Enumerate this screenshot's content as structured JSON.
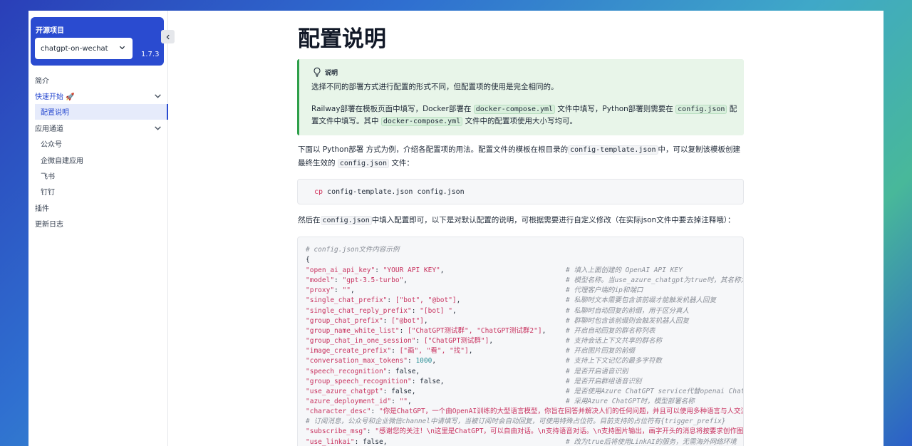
{
  "sidebar": {
    "project_title": "开源项目",
    "project_select": "chatgpt-on-wechat",
    "version": "1.7.3",
    "nav": [
      {
        "label": "简介",
        "type": "top"
      },
      {
        "label": "快速开始 🚀",
        "type": "top",
        "expanded": true
      },
      {
        "label": "配置说明",
        "type": "sub",
        "active": true
      },
      {
        "label": "应用通道",
        "type": "top",
        "expanded": true
      },
      {
        "label": "公众号",
        "type": "sub"
      },
      {
        "label": "企微自建应用",
        "type": "sub"
      },
      {
        "label": "飞书",
        "type": "sub"
      },
      {
        "label": "钉钉",
        "type": "sub"
      },
      {
        "label": "插件",
        "type": "top"
      },
      {
        "label": "更新日志",
        "type": "top"
      }
    ]
  },
  "main": {
    "title": "配置说明",
    "tip": {
      "heading": "说明",
      "p1": "选择不同的部署方式进行配置的形式不同，但配置项的使用是完全相同的。",
      "p2_a": "Railway部署在模板页面中填写，Docker部署在",
      "p2_code1": "docker-compose.yml",
      "p2_b": "文件中填写，Python部署则需要在",
      "p2_code2": "config.json",
      "p2_c": "配置文件中填写。其中",
      "p2_code3": "docker-compose.yml",
      "p2_d": "文件中的配置项使用大小写均可。"
    },
    "para1_a": "下面以 Python部署 方式为例，介绍各配置项的用法。配置文件的模板在根目录的",
    "para1_code1": "config-template.json",
    "para1_b": "中，可以复制该模板创建最终生效的",
    "para1_code2": "config.json",
    "para1_c": "文件：",
    "command_kw": "cp",
    "command_rest": "config-template.json config.json",
    "para2_a": "然后在",
    "para2_code": "config.json",
    "para2_b": "中填入配置即可，以下是对默认配置的说明，可根据需要进行自定义修改（在实际json文件中要去掉注释哦）：",
    "code_header_comment": "# config.json文件内容示例",
    "code_open_brace": "{",
    "config_lines": [
      {
        "key": "\"open_ai_api_key\"",
        "value": "\"YOUR API KEY\"",
        "vtype": "s",
        "comment": "# 填入上面创建的 OpenAI API KEY"
      },
      {
        "key": "\"model\"",
        "value": "\"gpt-3.5-turbo\"",
        "vtype": "s",
        "comment": "# 模型名称。当use_azure_chatgpt为true时，其名称为Azure上model deployment名称"
      },
      {
        "key": "\"proxy\"",
        "value": "\"\"",
        "vtype": "s",
        "comment": "# 代理客户端的ip和端口"
      },
      {
        "key": "\"single_chat_prefix\"",
        "value": "[\"bot\", \"@bot\"]",
        "vtype": "s",
        "comment": "# 私聊时文本需要包含该前缀才能触发机器人回复"
      },
      {
        "key": "\"single_chat_reply_prefix\"",
        "value": "\"[bot] \"",
        "vtype": "s",
        "comment": "# 私聊时自动回复的前缀，用于区分真人"
      },
      {
        "key": "\"group_chat_prefix\"",
        "value": "[\"@bot\"]",
        "vtype": "s",
        "comment": "# 群聊时包含该前缀则会触发机器人回复"
      },
      {
        "key": "\"group_name_white_list\"",
        "value": "[\"ChatGPT测试群\", \"ChatGPT测试群2\"]",
        "vtype": "s",
        "comment": "# 开启自动回复的群名称列表"
      },
      {
        "key": "\"group_chat_in_one_session\"",
        "value": "[\"ChatGPT测试群\"]",
        "vtype": "s",
        "comment": "# 支持会话上下文共享的群名称"
      },
      {
        "key": "\"image_create_prefix\"",
        "value": "[\"画\", \"看\", \"找\"]",
        "vtype": "s",
        "comment": "# 开启图片回复的前缀"
      },
      {
        "key": "\"conversation_max_tokens\"",
        "value": "1000",
        "vtype": "n",
        "comment": "# 支持上下文记忆的最多字符数"
      },
      {
        "key": "\"speech_recognition\"",
        "value": "false",
        "vtype": "p",
        "comment": "# 是否开启语音识别"
      },
      {
        "key": "\"group_speech_recognition\"",
        "value": "false",
        "vtype": "p",
        "comment": "# 是否开启群组语音识别"
      },
      {
        "key": "\"use_azure_chatgpt\"",
        "value": "false",
        "vtype": "p",
        "comment": "# 是否使用Azure ChatGPT service代替openai ChatGPT service"
      },
      {
        "key": "\"azure_deployment_id\"",
        "value": "\"\"",
        "vtype": "s",
        "comment": "# 采用Azure ChatGPT时，模型部署名称"
      },
      {
        "key": "\"character_desc\"",
        "value": "\"你是ChatGPT，一个由OpenAI训练的大型语言模型，你旨在回答并解决人们的任何问题，并且可以使用多种语言与人交流。\"",
        "vtype": "s",
        "comment": ""
      }
    ],
    "standalone_comment": "# 订阅消息，公众号和企业微信channel中请填写，当被订阅时会自动回复，可使用特殊占位符。目前支持的占位符有{trigger_prefix}",
    "subscribe_line": {
      "key": "\"subscribe_msg\"",
      "value": "\"感谢您的关注！\\n这里是ChatGPT，可以自由对话。\\n支持语音对话。\\n支持图片输出，画字开头的消息将按要求创作图片。\""
    },
    "linkai_line": {
      "key": "\"use_linkai\"",
      "value": "false",
      "comment": "# 改为true后将使用LinkAI的服务，无需海外网络环境"
    }
  },
  "colors": {
    "accent": "#2a4bd0",
    "tip_border": "#2e9f4a",
    "tip_bg": "#e8f5e9",
    "code_key": "#c8325f",
    "code_number": "#2a8f96",
    "code_comment": "#8a8f98"
  }
}
